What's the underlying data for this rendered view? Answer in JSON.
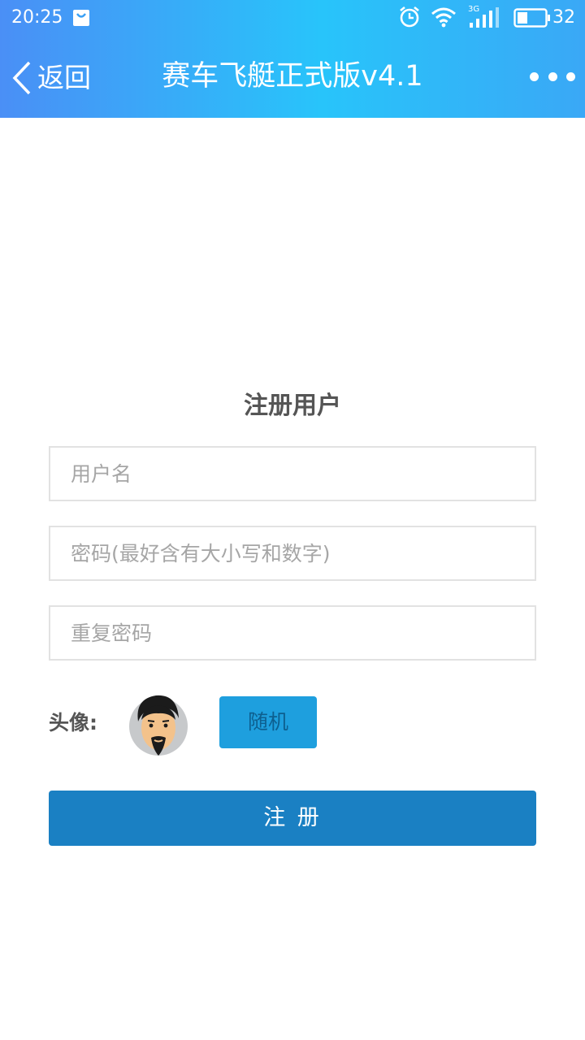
{
  "status_bar": {
    "time": "20:25",
    "network": "3G",
    "battery": "32",
    "icons": [
      "shopping-bag-icon",
      "alarm-clock-icon",
      "wifi-icon",
      "cellular-signal-icon",
      "battery-icon"
    ]
  },
  "nav": {
    "back_label": "返回",
    "title": "赛车飞艇正式版v4.1",
    "more_icon": "more-dots-icon"
  },
  "form": {
    "title": "注册用户",
    "username": {
      "value": "",
      "placeholder": "用户名"
    },
    "password": {
      "value": "",
      "placeholder": "密码(最好含有大小写和数字)"
    },
    "confirm_password": {
      "value": "",
      "placeholder": "重复密码"
    },
    "avatar_label": "头像:",
    "random_label": "随机",
    "submit_label": "注 册"
  },
  "colors": {
    "header_gradient_start": "#4a8ff6",
    "header_gradient_mid": "#28c4fa",
    "random_button": "#1e9fde",
    "submit_button": "#1a80c3",
    "title_text": "#555555",
    "placeholder_text": "#a6a6a6",
    "input_border": "#e2e2e2"
  }
}
